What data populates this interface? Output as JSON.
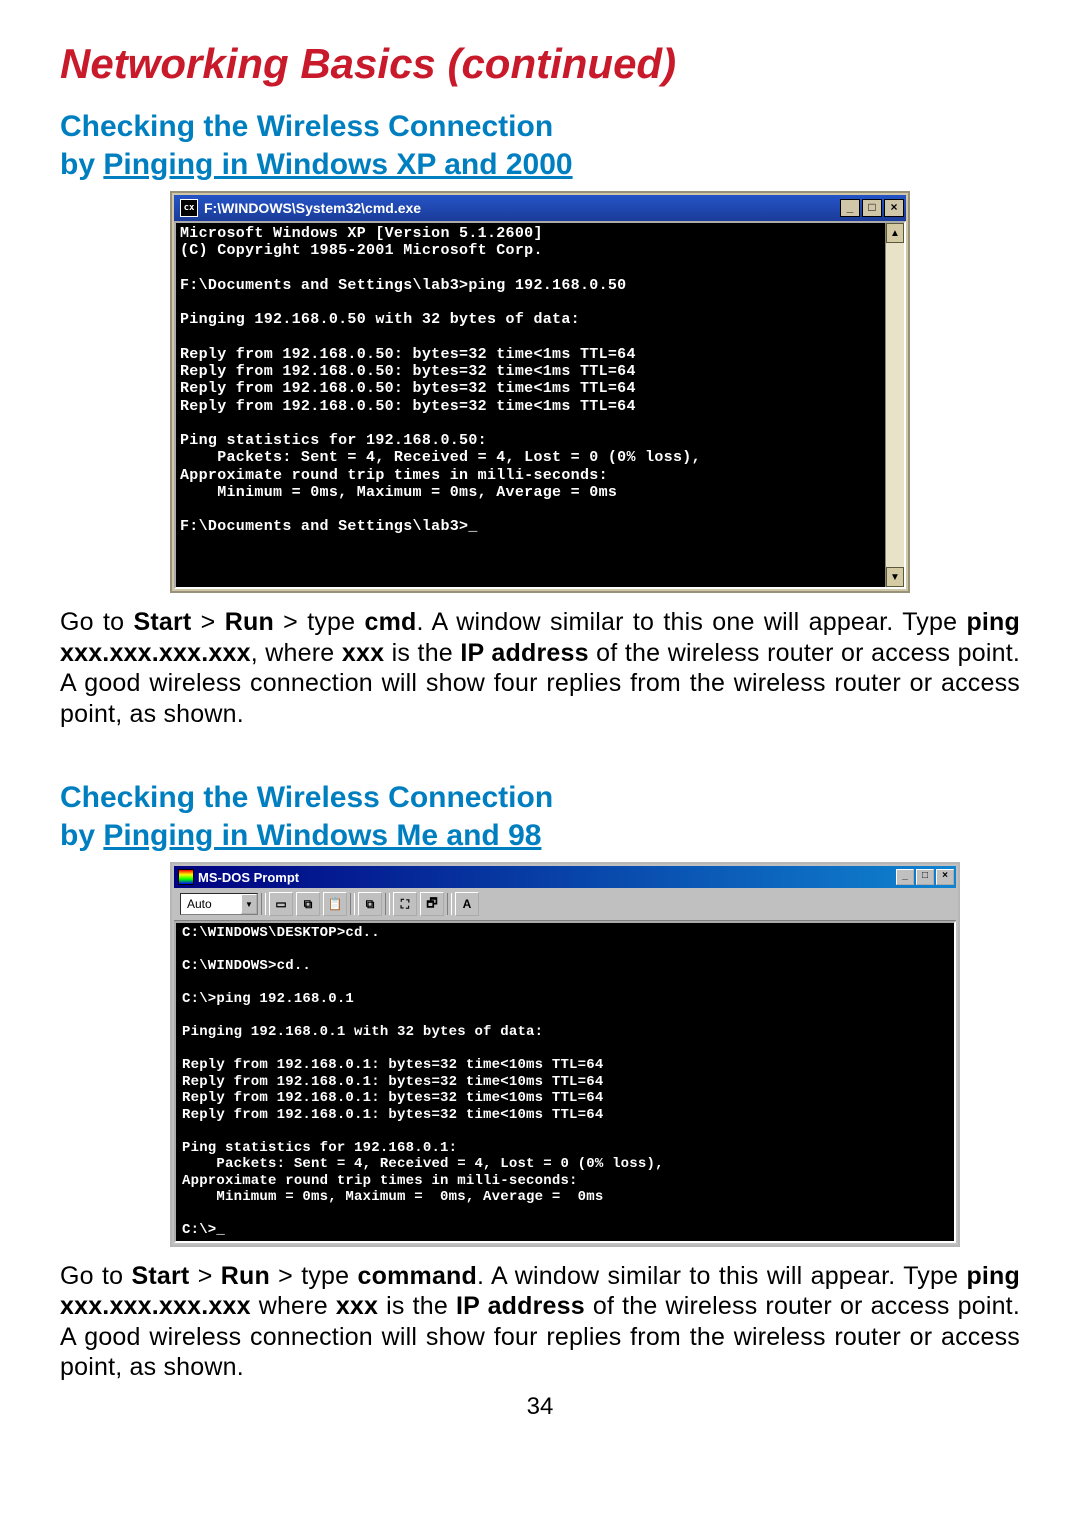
{
  "title": "Networking Basics (continued)",
  "section1": {
    "heading_line1": "Checking the Wireless Connection",
    "heading_line2": "by ",
    "heading_underline": "Pinging in Windows XP and 2000",
    "cmd_title_prefix": "cx",
    "cmd_title": "F:\\WINDOWS\\System32\\cmd.exe",
    "minimize": "_",
    "maximize": "□",
    "close": "×",
    "up_arrow": "▲",
    "down_arrow": "▼",
    "console": "Microsoft Windows XP [Version 5.1.2600]\n(C) Copyright 1985-2001 Microsoft Corp.\n\nF:\\Documents and Settings\\lab3>ping 192.168.0.50\n\nPinging 192.168.0.50 with 32 bytes of data:\n\nReply from 192.168.0.50: bytes=32 time<1ms TTL=64\nReply from 192.168.0.50: bytes=32 time<1ms TTL=64\nReply from 192.168.0.50: bytes=32 time<1ms TTL=64\nReply from 192.168.0.50: bytes=32 time<1ms TTL=64\n\nPing statistics for 192.168.0.50:\n    Packets: Sent = 4, Received = 4, Lost = 0 (0% loss),\nApproximate round trip times in milli-seconds:\n    Minimum = 0ms, Maximum = 0ms, Average = 0ms\n\nF:\\Documents and Settings\\lab3>_",
    "para_goTo": "Go to ",
    "para_start": "Start",
    "para_gt1": " > ",
    "para_run": "Run",
    "para_gt2": " > type ",
    "para_cmd": "cmd",
    "para_afterCmd": ". A window similar to this one will appear. Type ",
    "para_pingCmd": "ping xxx.xxx.xxx.xxx",
    "para_where": ", where ",
    "para_xxx": "xxx",
    "para_isThe": " is the ",
    "para_ip": "IP address",
    "para_rest": " of the wireless router or access point.  A good wireless connection will show four replies from the wireless router or access point, as shown."
  },
  "section2": {
    "heading_line1": "Checking the Wireless Connection",
    "heading_line2": "by ",
    "heading_underline": "Pinging in Windows Me and 98",
    "win_title": "MS-DOS Prompt",
    "minimize": "_",
    "maximize": "□",
    "close": "×",
    "combo": "Auto",
    "tb_icons": [
      "▭",
      "⧉",
      "📋",
      "⧉",
      "⛶",
      "🗗",
      "A"
    ],
    "console": "C:\\WINDOWS\\DESKTOP>cd..\n\nC:\\WINDOWS>cd..\n\nC:\\>ping 192.168.0.1\n\nPinging 192.168.0.1 with 32 bytes of data:\n\nReply from 192.168.0.1: bytes=32 time<10ms TTL=64\nReply from 192.168.0.1: bytes=32 time<10ms TTL=64\nReply from 192.168.0.1: bytes=32 time<10ms TTL=64\nReply from 192.168.0.1: bytes=32 time<10ms TTL=64\n\nPing statistics for 192.168.0.1:\n    Packets: Sent = 4, Received = 4, Lost = 0 (0% loss),\nApproximate round trip times in milli-seconds:\n    Minimum = 0ms, Maximum =  0ms, Average =  0ms\n\nC:\\>_",
    "para_goTo": "Go to ",
    "para_start": "Start",
    "para_gt1": " > ",
    "para_run": "Run",
    "para_gt2": " > type ",
    "para_cmd": "command",
    "para_afterCmd": ". A window similar to this will appear. Type ",
    "para_pingCmd": "ping xxx.xxx.xxx.xxx",
    "para_where": " where ",
    "para_xxx": "xxx",
    "para_isThe": " is the ",
    "para_ip": "IP address",
    "para_rest": " of the wireless router or access point. A good wireless connection will show four replies from the wireless router or access point, as shown."
  },
  "page_number": "34"
}
